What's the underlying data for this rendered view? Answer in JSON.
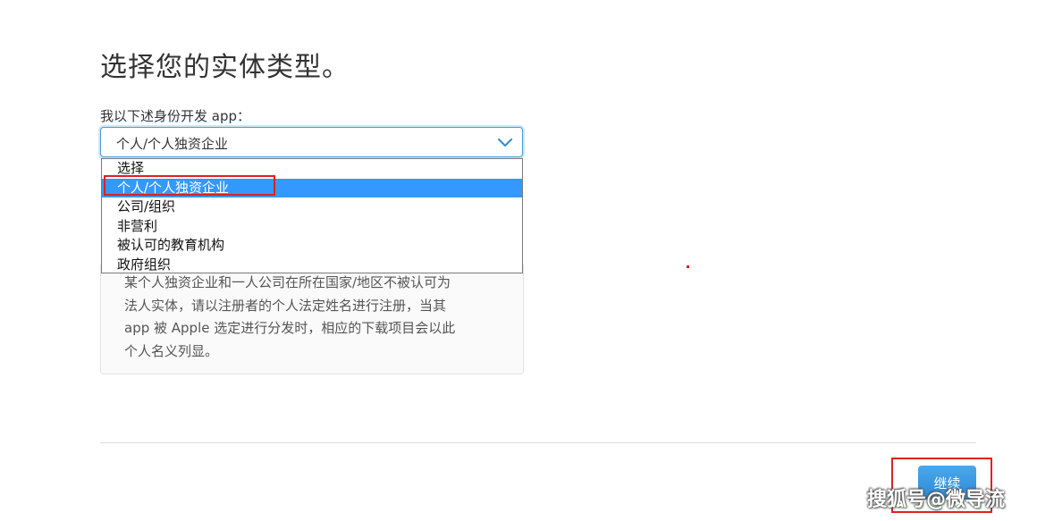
{
  "page": {
    "title": "选择您的实体类型。"
  },
  "entity_field": {
    "label": "我以下述身份开发 app：",
    "selected_value": "个人/个人独资企业",
    "options": [
      "选择",
      "个人/个人独资企业",
      "公司/组织",
      "非营利",
      "被认可的教育机构",
      "政府组织"
    ],
    "selected_index": 1
  },
  "info_panel": {
    "line_1": "某个人独资企业和一人公司在所在国家/地区不被认可为",
    "line_2": "法人实体，请以注册者的个人法定姓名进行注册，当其",
    "line_3": "app 被 Apple 选定进行分发时，相应的下载项目会以此",
    "line_4": "个人名义列显。"
  },
  "actions": {
    "continue_label": "继续"
  },
  "watermark": {
    "text": "搜狐号@微导流"
  },
  "colors": {
    "accent_blue": "#3399ff",
    "button_blue": "#2c88d6",
    "annotation_red": "#e02020"
  },
  "icons": {
    "select_arrow": "chevron-down-icon"
  }
}
